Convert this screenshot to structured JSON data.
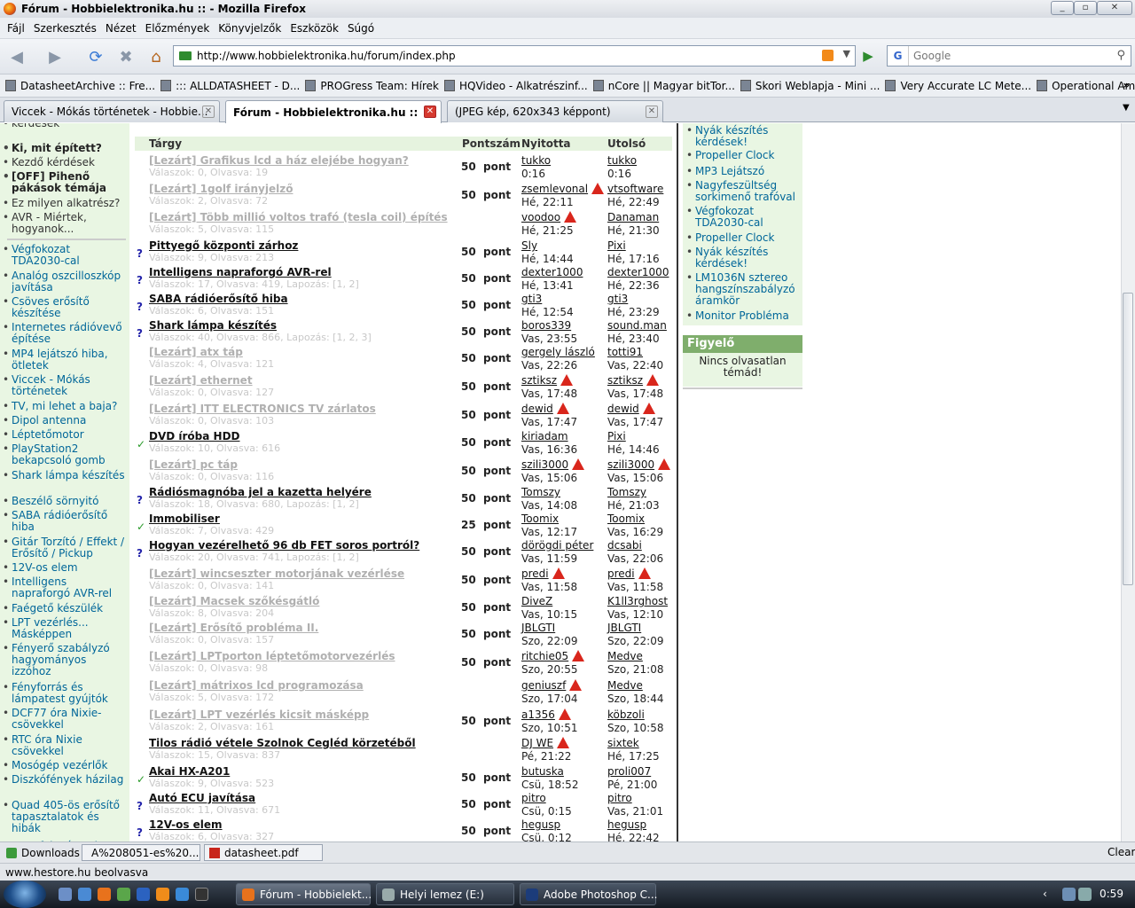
{
  "window": {
    "title": "Fórum - Hobbielektronika.hu :: - Mozilla Firefox"
  },
  "menu": [
    "Fájl",
    "Szerkesztés",
    "Nézet",
    "Előzmények",
    "Könyvjelzők",
    "Eszközök",
    "Súgó"
  ],
  "address": {
    "url": "http://www.hobbielektronika.hu/forum/index.php"
  },
  "search": {
    "engine": "G",
    "placeholder": "Google"
  },
  "bookmarks": [
    "DatasheetArchive :: Fre...",
    "::: ALLDATASHEET - D...",
    "PROGress Team: Hírek",
    "HQVideo - Alkatrészinf...",
    "nCore || Magyar bitTor...",
    "Skori Weblapja - Mini ...",
    "Very Accurate LC Mete...",
    "Operational Amplifier ..."
  ],
  "tabs": [
    {
      "label": "Viccek - Mókás történetek - Hobbie..."
    },
    {
      "label": "Fórum - Hobbielektronika.hu ::"
    },
    {
      "label": "(JPEG kép, 620x343 képpont)"
    }
  ],
  "left_nav": {
    "top": [
      {
        "text": "kérdések",
        "cls": "dark"
      },
      {
        "text": "Ki, mit épített?",
        "cls": "bold"
      },
      {
        "text": "Kezdő kérdések",
        "cls": "dark"
      },
      {
        "text": "[OFF] Pihenő pákások témája",
        "cls": "bold"
      },
      {
        "text": "Ez milyen alkatrész?",
        "cls": "dark"
      },
      {
        "text": "AVR - Miértek, hogyanok...",
        "cls": "dark"
      }
    ],
    "items": [
      "Végfokozat TDA2030-cal",
      "Analóg oszcilloszkóp javítása",
      "Csöves erősítő készítése",
      "Internetes rádióvevő építése",
      "MP4 lejátszó hiba, ötletek",
      "Viccek - Mókás történetek",
      "TV, mi lehet a baja?",
      "Dipol antenna",
      "Léptetőmotor",
      "PlayStation2 bekapcsoló gomb",
      "Shark lámpa készítés",
      "Beszélő sörnyitó",
      "SABA rádióerősítő hiba",
      "Gitár Torzító / Effekt / Erősítő / Pickup",
      "12V-os elem",
      "Intelligens napraforgó AVR-rel",
      "Faégető készülék",
      "LPT vezérlés... Másképpen",
      "Fényerő szabályzó hagyományos izzóhoz",
      "Fényforrás és lámpatest gyújtók",
      "DCF77 óra Nixie-csövekkel",
      "RTC óra Nixie csövekkel",
      "Mosógép vezérlők",
      "Diszkófények házilag",
      "Quad 405-ös erősítő tapasztalatok és hibák",
      "Hangfalgyár IC-k"
    ]
  },
  "table": {
    "headers": {
      "subject": "Tárgy",
      "points": "Pontszám",
      "started": "Nyitotta",
      "last": "Utolsó"
    },
    "rows": [
      {
        "icon": "",
        "lock": true,
        "title": "[Lezárt] Grafikus lcd a ház elejébe hogyan?",
        "sub": "Válaszok: 0, Olvasva: 19",
        "points": "50  pont",
        "u1": "tukko",
        "w1": false,
        "t1": "0:16",
        "u2": "tukko",
        "w2": false,
        "t2": "0:16"
      },
      {
        "icon": "",
        "lock": true,
        "title": "[Lezárt] 1golf irányjelző",
        "sub": "Válaszok: 2, Olvasva: 72",
        "points": "50  pont",
        "u1": "zsemlevonal",
        "w1": true,
        "t1": "Hé, 22:11",
        "u2": "vtsoftware",
        "w2": false,
        "t2": "Hé, 22:49"
      },
      {
        "icon": "",
        "lock": true,
        "title": "[Lezárt] Több millió voltos trafó (tesla coil) építés",
        "sub": "Válaszok: 5, Olvasva: 115",
        "points": "",
        "u1": "voodoo",
        "w1": true,
        "t1": "Hé, 21:25",
        "u2": "Danaman",
        "w2": false,
        "t2": "Hé, 21:30"
      },
      {
        "icon": "?",
        "lock": false,
        "title": "Pittyegő központi zárhoz",
        "sub": "Válaszok: 9, Olvasva: 213",
        "points": "50  pont",
        "u1": "Sly",
        "w1": false,
        "t1": "Hé, 14:44",
        "u2": "Pixi",
        "w2": false,
        "t2": "Hé, 17:16"
      },
      {
        "icon": "?",
        "lock": false,
        "title": "Intelligens napraforgó AVR-rel",
        "sub": "Válaszok: 17, Olvasva: 419, Lapozás: [1, 2]",
        "points": "50  pont",
        "u1": "dexter1000",
        "w1": false,
        "t1": "Hé, 13:41",
        "u2": "dexter1000",
        "w2": false,
        "t2": "Hé, 22:36"
      },
      {
        "icon": "?",
        "lock": false,
        "title": "SABA rádióerősítő hiba",
        "sub": "Válaszok: 6, Olvasva: 151",
        "points": "50  pont",
        "u1": "gti3",
        "w1": false,
        "t1": "Hé, 12:54",
        "u2": "gti3",
        "w2": false,
        "t2": "Hé, 23:29"
      },
      {
        "icon": "?",
        "lock": false,
        "title": "Shark lámpa készítés",
        "sub": "Válaszok: 40, Olvasva: 866, Lapozás: [1, 2, 3]",
        "points": "50  pont",
        "u1": "boros339",
        "w1": false,
        "t1": "Vas, 23:55",
        "u2": "sound.man",
        "w2": false,
        "t2": "Hé, 23:40"
      },
      {
        "icon": "",
        "lock": true,
        "title": "[Lezárt] atx táp",
        "sub": "Válaszok: 4, Olvasva: 121",
        "points": "50  pont",
        "u1": "gergely lászló",
        "w1": false,
        "t1": "Vas, 22:26",
        "u2": "totti91",
        "w2": false,
        "t2": "Vas, 22:40"
      },
      {
        "icon": "",
        "lock": true,
        "title": "[Lezárt] ethernet",
        "sub": "Válaszok: 0, Olvasva: 127",
        "points": "50  pont",
        "u1": "sztiksz",
        "w1": true,
        "t1": "Vas, 17:48",
        "u2": "sztiksz",
        "w2": true,
        "t2": "Vas, 17:48"
      },
      {
        "icon": "",
        "lock": true,
        "title": "[Lezárt] ITT ELECTRONICS TV zárlatos",
        "sub": "Válaszok: 0, Olvasva: 103",
        "points": "50  pont",
        "u1": "dewid",
        "w1": true,
        "t1": "Vas, 17:47",
        "u2": "dewid",
        "w2": true,
        "t2": "Vas, 17:47"
      },
      {
        "icon": "✓",
        "lock": false,
        "title": "DVD íróba HDD",
        "sub": "Válaszok: 10, Olvasva: 616",
        "points": "50  pont",
        "u1": "kiriadam",
        "w1": false,
        "t1": "Vas, 16:36",
        "u2": "Pixi",
        "w2": false,
        "t2": "Hé, 14:46"
      },
      {
        "icon": "",
        "lock": true,
        "title": "[Lezárt] pc táp",
        "sub": "Válaszok: 0, Olvasva: 116",
        "points": "50  pont",
        "u1": "szili3000",
        "w1": true,
        "t1": "Vas, 15:06",
        "u2": "szili3000",
        "w2": true,
        "t2": "Vas, 15:06"
      },
      {
        "icon": "?",
        "lock": false,
        "title": "Rádiósmagnóba jel a kazetta helyére",
        "sub": "Válaszok: 18, Olvasva: 680, Lapozás: [1, 2]",
        "points": "50  pont",
        "u1": "Tomszy",
        "w1": false,
        "t1": "Vas, 14:08",
        "u2": "Tomszy",
        "w2": false,
        "t2": "Hé, 21:03"
      },
      {
        "icon": "✓",
        "lock": false,
        "title": "Immobiliser",
        "sub": "Válaszok: 7, Olvasva: 429",
        "points": "25  pont",
        "u1": "Toomix",
        "w1": false,
        "t1": "Vas, 12:17",
        "u2": "Toomix",
        "w2": false,
        "t2": "Vas, 16:29"
      },
      {
        "icon": "?",
        "lock": false,
        "title": "Hogyan vezérelhető 96 db FET soros portról?",
        "sub": "Válaszok: 20, Olvasva: 741, Lapozás: [1, 2]",
        "points": "50  pont",
        "u1": "dörögdi péter",
        "w1": false,
        "t1": "Vas, 11:59",
        "u2": "dcsabi",
        "w2": false,
        "t2": "Vas, 22:06"
      },
      {
        "icon": "",
        "lock": true,
        "title": "[Lezárt] wincseszter motorjának vezérlése",
        "sub": "Válaszok: 0, Olvasva: 141",
        "points": "50  pont",
        "u1": "predi",
        "w1": true,
        "t1": "Vas, 11:58",
        "u2": "predi",
        "w2": true,
        "t2": "Vas, 11:58"
      },
      {
        "icon": "",
        "lock": true,
        "title": "[Lezárt] Macsek szőkésgátló",
        "sub": "Válaszok: 8, Olvasva: 204",
        "points": "50  pont",
        "u1": "DiveZ",
        "w1": false,
        "t1": "Vas, 10:15",
        "u2": "K1ll3rghost",
        "w2": false,
        "t2": "Vas, 12:10"
      },
      {
        "icon": "",
        "lock": true,
        "title": "[Lezárt] Erősítő probléma II.",
        "sub": "Válaszok: 0, Olvasva: 157",
        "points": "50  pont",
        "u1": "JBLGTI",
        "w1": false,
        "t1": "Szo, 22:09",
        "u2": "JBLGTI",
        "w2": false,
        "t2": "Szo, 22:09"
      },
      {
        "icon": "",
        "lock": true,
        "title": "[Lezárt] LPTporton léptetőmotorvezérlés",
        "sub": "Válaszok: 0, Olvasva: 98",
        "points": "50  pont",
        "u1": "ritchie05",
        "w1": true,
        "t1": "Szo, 20:55",
        "u2": "Medve",
        "w2": false,
        "t2": "Szo, 21:08"
      },
      {
        "icon": "",
        "lock": true,
        "title": "[Lezárt] mátrixos lcd programozása",
        "sub": "Válaszok: 5, Olvasva: 172",
        "points": "",
        "u1": "geniuszf",
        "w1": true,
        "t1": "Szo, 17:04",
        "u2": "Medve",
        "w2": false,
        "t2": "Szo, 18:44"
      },
      {
        "icon": "",
        "lock": true,
        "title": "[Lezárt] LPT vezérlés kicsit másképp",
        "sub": "Válaszok: 2, Olvasva: 161",
        "points": "50  pont",
        "u1": "a1356",
        "w1": true,
        "t1": "Szo, 10:51",
        "u2": "köbzoli",
        "w2": false,
        "t2": "Szo, 10:58"
      },
      {
        "icon": "",
        "lock": false,
        "title": "Tilos rádió vétele Szolnok Cegléd körzetéből",
        "sub": "Válaszok: 15, Olvasva: 837",
        "points": "",
        "u1": "DJ WE",
        "w1": true,
        "t1": "Pé, 21:22",
        "u2": "sixtek",
        "w2": false,
        "t2": "Hé, 17:25"
      },
      {
        "icon": "✓",
        "lock": false,
        "title": "Akai HX-A201",
        "sub": "Válaszok: 9, Olvasva: 523",
        "points": "50  pont",
        "u1": "butuska",
        "w1": false,
        "t1": "Csü, 18:52",
        "u2": "proli007",
        "w2": false,
        "t2": "Pé, 21:00"
      },
      {
        "icon": "?",
        "lock": false,
        "title": "Autó ECU javítása",
        "sub": "Válaszok: 11, Olvasva: 671",
        "points": "50  pont",
        "u1": "pitro",
        "w1": false,
        "t1": "Csü, 0:15",
        "u2": "pitro",
        "w2": false,
        "t2": "Vas, 21:01"
      },
      {
        "icon": "?",
        "lock": false,
        "title": "12V-os elem",
        "sub": "Válaszok: 6, Olvasva: 327",
        "points": "50  pont",
        "u1": "hegusp",
        "w1": false,
        "t1": "Csü, 0:12",
        "u2": "hegusp",
        "w2": false,
        "t2": "Hé, 22:42"
      }
    ]
  },
  "right_nav": {
    "items": [
      "Nyák készítés kérdések!",
      "Propeller Clock",
      "MP3 Lejátszó",
      "Nagyfeszültség sorkimenő trafóval",
      "Végfokozat TDA2030-cal",
      "Propeller Clock",
      "Nyák készítés kérdések!",
      "LM1036N sztereo hangszínszabályzó áramkör",
      "Monitor Probléma"
    ]
  },
  "watch": {
    "title": "Figyelő",
    "body": "Nincs olvasatlan témád!"
  },
  "downloads": {
    "label": "Downloads",
    "items": [
      "A%208051-es%20...",
      "datasheet.pdf"
    ],
    "clear": "Clear"
  },
  "status": "www.hestore.hu beolvasva",
  "taskbar": {
    "buttons": [
      "Fórum - Hobbielekt...",
      "Helyi lemez (E:)",
      "Adobe Photoshop C..."
    ],
    "clock": "0:59"
  }
}
